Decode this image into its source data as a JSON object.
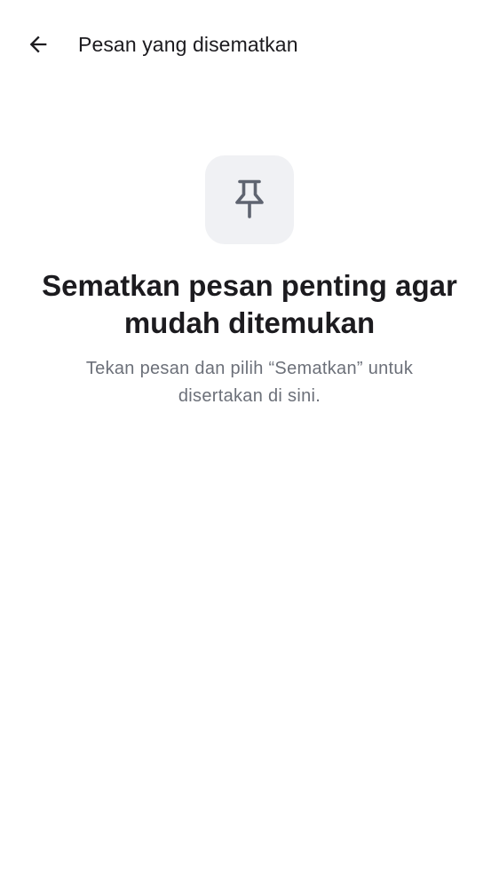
{
  "app_bar": {
    "back_icon": "arrow-back-icon",
    "title": "Pesan yang disematkan"
  },
  "empty_state": {
    "icon": "push-pin-icon",
    "headline": "Sematkan pesan penting agar mudah ditemukan",
    "subtext": "Tekan pesan dan pilih “Sematkan” untuk disertakan di sini."
  },
  "colors": {
    "text_primary": "#1c1b1f",
    "text_secondary": "#6c7079",
    "icon_tile_bg": "#f0f1f4",
    "pin_icon": "#5f6470",
    "background": "#ffffff"
  }
}
